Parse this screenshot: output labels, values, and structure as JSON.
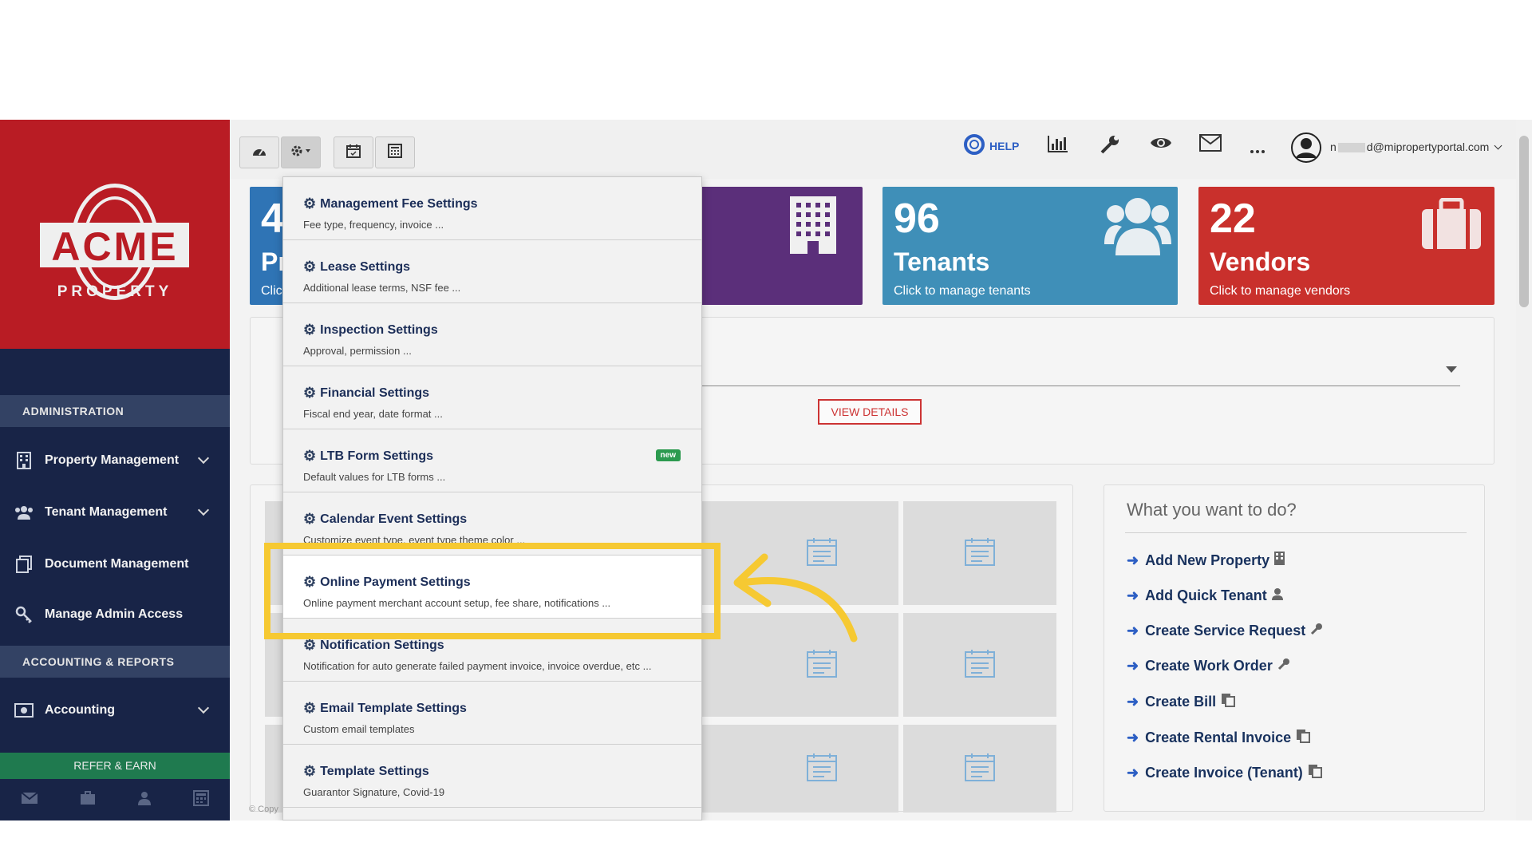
{
  "logo": {
    "text": "ACME",
    "sub": "PROPERTY"
  },
  "sidebar": {
    "sections": [
      {
        "label": "ADMINISTRATION"
      },
      {
        "label": "ACCOUNTING & REPORTS"
      }
    ],
    "items": [
      {
        "label": "Property Management",
        "icon": "building-icon"
      },
      {
        "label": "Tenant Management",
        "icon": "users-icon"
      },
      {
        "label": "Document Management",
        "icon": "document-icon"
      },
      {
        "label": "Manage Admin Access",
        "icon": "key-icon"
      },
      {
        "label": "Accounting",
        "icon": "money-icon"
      }
    ],
    "refer": "REFER & EARN"
  },
  "topbar": {
    "help": "HELP",
    "email_prefix": "n",
    "email_suffix": "d@mipropertyportal.com"
  },
  "cards": {
    "tenants": {
      "num": "96",
      "label": "Tenants",
      "sub": "Click to manage tenants",
      "color": "#3f8fb8"
    },
    "vendors": {
      "num": "22",
      "label": "Vendors",
      "sub": "Click to manage vendors",
      "color": "#c9302c"
    },
    "purple_color": "#5b2f7a",
    "blue_color": "#2f74b5",
    "partial_num": "4",
    "partial_label": "Pr",
    "partial_sub": "Clic"
  },
  "view_details": "VIEW DETAILS",
  "dropdown": {
    "items": [
      {
        "title": "Management Fee Settings",
        "desc": "Fee type, frequency, invoice ..."
      },
      {
        "title": "Lease Settings",
        "desc": "Additional lease terms, NSF fee ..."
      },
      {
        "title": "Inspection Settings",
        "desc": "Approval, permission ..."
      },
      {
        "title": "Financial Settings",
        "desc": "Fiscal end year, date format ..."
      },
      {
        "title": "LTB Form Settings",
        "desc": "Default values for LTB forms ...",
        "badge": "new"
      },
      {
        "title": "Calendar Event Settings",
        "desc": "Customize event type, event type theme color ..."
      },
      {
        "title": "Online Payment Settings",
        "desc": "Online payment merchant account setup, fee share, notifications ..."
      },
      {
        "title": "Notification Settings",
        "desc": "Notification for auto generate failed payment invoice, invoice overdue, etc ..."
      },
      {
        "title": "Email Template Settings",
        "desc": "Custom email templates"
      },
      {
        "title": "Template Settings",
        "desc": "Guarantor Signature, Covid-19"
      }
    ]
  },
  "actions": {
    "title": "What you want to do?",
    "items": [
      {
        "label": "Add New Property",
        "icon": "building-icon"
      },
      {
        "label": "Add Quick Tenant",
        "icon": "user-icon"
      },
      {
        "label": "Create Service Request",
        "icon": "wrench-icon"
      },
      {
        "label": "Create Work Order",
        "icon": "wrench-icon"
      },
      {
        "label": "Create Bill",
        "icon": "copy-icon"
      },
      {
        "label": "Create Rental Invoice",
        "icon": "copy-icon"
      },
      {
        "label": "Create Invoice (Tenant)",
        "icon": "copy-icon"
      }
    ]
  },
  "copyright": "© Copy",
  "highlight_color": "#f6c932"
}
